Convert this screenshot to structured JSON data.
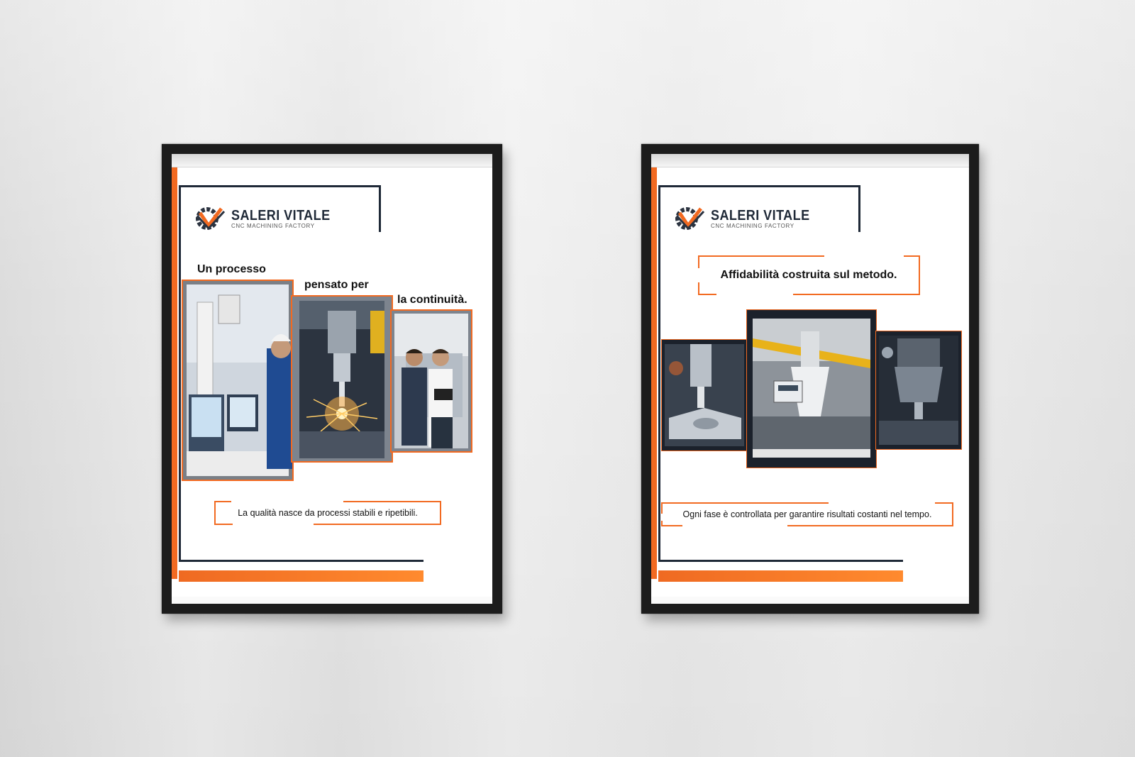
{
  "posters": [
    {
      "brand": {
        "name": "SALERI VITALE",
        "tagline": "CNC MACHINING FACTORY"
      },
      "headline_parts": [
        "Un processo",
        "pensato per",
        "la continuità."
      ],
      "caption": "La qualità nasce da processi stabili e ripetibili."
    },
    {
      "brand": {
        "name": "SALERI VITALE",
        "tagline": "CNC MACHINING FACTORY"
      },
      "headline": "Affidabilità costruita sul metodo.",
      "caption": "Ogni fase è controllata per garantire risultati costanti nel tempo."
    }
  ],
  "colors": {
    "accent": "#f26a21",
    "navy": "#1f2937",
    "frame": "#1c1c1c"
  }
}
